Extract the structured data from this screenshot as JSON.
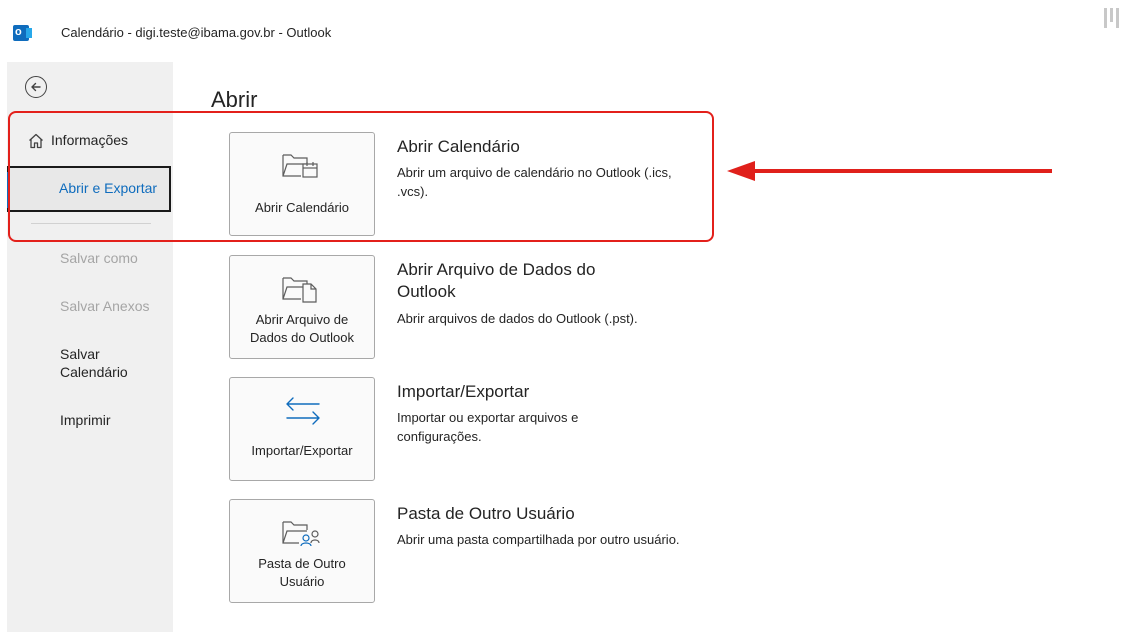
{
  "window": {
    "title": "Calendário - digi.teste@ibama.gov.br  -  Outlook",
    "app_icon_letter": "o"
  },
  "sidebar": {
    "back_icon": "back-arrow-icon",
    "items": [
      {
        "label": "Informações",
        "icon": "home-icon",
        "state": "normal"
      },
      {
        "label": "Abrir e Exportar",
        "state": "selected"
      },
      {
        "label": "Salvar como",
        "state": "disabled"
      },
      {
        "label": "Salvar Anexos",
        "state": "disabled"
      },
      {
        "label_line1": "Salvar",
        "label_line2": "Calendário",
        "state": "normal"
      },
      {
        "label": "Imprimir",
        "state": "normal"
      }
    ]
  },
  "main": {
    "heading": "Abrir",
    "options": [
      {
        "tile_label": "Abrir Calendário",
        "icon": "folder-calendar-icon",
        "title": "Abrir Calendário",
        "description": "Abrir um arquivo de calendário no Outlook (.ics, .vcs)."
      },
      {
        "tile_label_line1": "Abrir Arquivo de",
        "tile_label_line2": "Dados do Outlook",
        "icon": "folder-document-icon",
        "title": "Abrir Arquivo de Dados do Outlook",
        "description": "Abrir arquivos de dados do Outlook (.pst)."
      },
      {
        "tile_label": "Importar/Exportar",
        "icon": "import-export-arrows-icon",
        "title": "Importar/Exportar",
        "description": "Importar ou exportar arquivos e configurações."
      },
      {
        "tile_label_line1": "Pasta de Outro",
        "tile_label_line2": "Usuário",
        "icon": "folder-user-icon",
        "title": "Pasta de Outro Usuário",
        "description": "Abrir uma pasta compartilhada por outro usuário."
      }
    ]
  },
  "colors": {
    "accent": "#0f6cbd",
    "annotation_red": "#e0201b",
    "sidebar_bg": "#f0f0f0"
  }
}
